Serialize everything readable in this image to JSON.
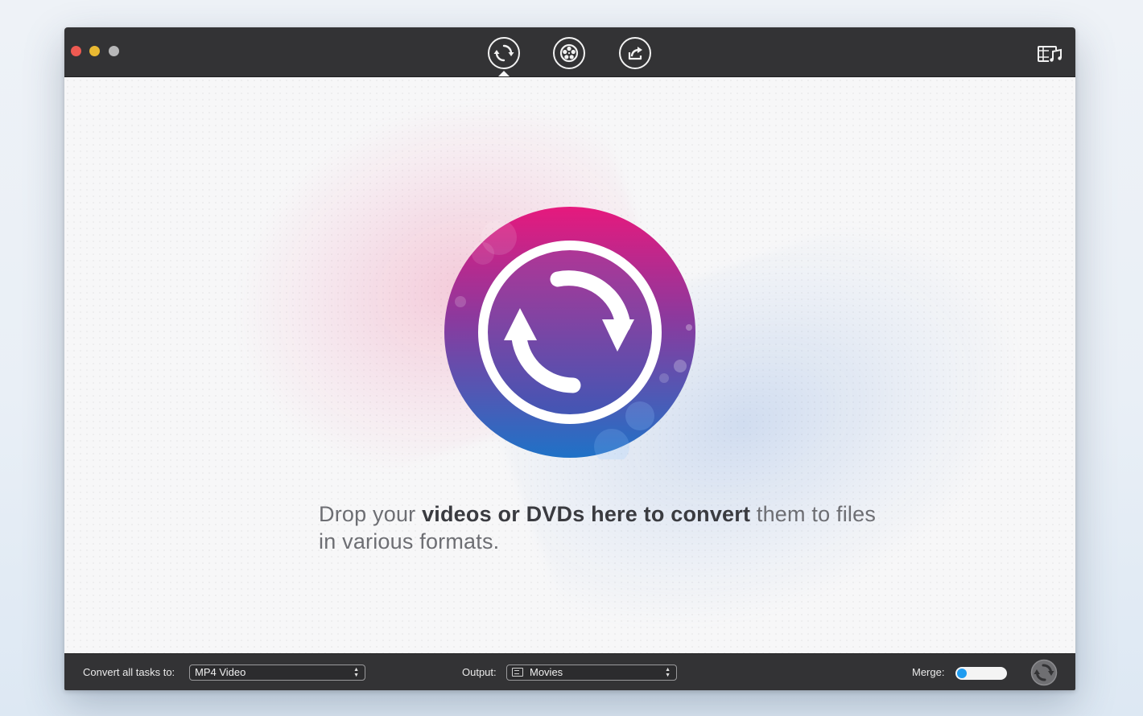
{
  "window": {
    "traffic_lights": [
      "close",
      "minimize",
      "zoom"
    ]
  },
  "toolbar": {
    "buttons": [
      {
        "id": "convert",
        "icon": "convert-arrows-icon",
        "active": true
      },
      {
        "id": "burn",
        "icon": "film-reel-icon",
        "active": false
      },
      {
        "id": "share",
        "icon": "share-icon",
        "active": false
      }
    ],
    "media_browser_icon": "media-browser-icon"
  },
  "main": {
    "hero_icon": "convert-logo-icon",
    "drop_text": {
      "part1": "Drop your ",
      "bold": "videos or DVDs here to convert",
      "part2": " them to files in various formats."
    }
  },
  "bottombar": {
    "convert_label": "Convert all tasks to:",
    "format_value": "MP4 Video",
    "output_label": "Output:",
    "output_value": "Movies",
    "merge_label": "Merge:",
    "merge_enabled": false,
    "start_icon": "start-convert-icon"
  },
  "colors": {
    "titlebar": "#333335",
    "accent_pink": "#e6197d",
    "accent_purple": "#7a3ea0",
    "accent_blue": "#1f6fc4",
    "toggle_knob": "#1f9cf0"
  }
}
